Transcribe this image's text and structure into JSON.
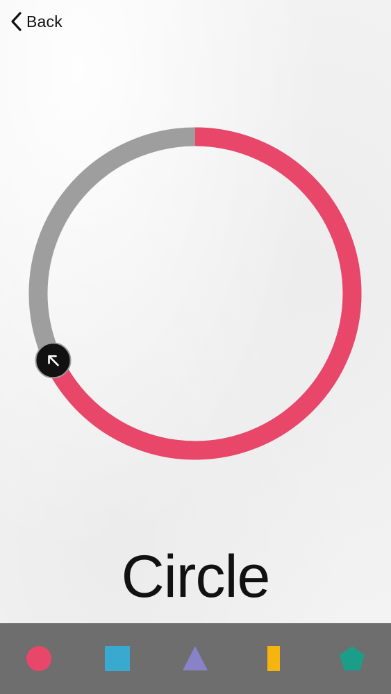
{
  "nav": {
    "back_label": "Back"
  },
  "shape_title": "Circle",
  "progress": {
    "fraction": 0.68,
    "track_color": "#9e9e9e",
    "fill_color": "#e8476a",
    "handle_color": "#111111",
    "handle_icon": "arrow-up-left-icon"
  },
  "shapes": [
    {
      "name": "circle",
      "color": "#e8476a"
    },
    {
      "name": "square",
      "color": "#3aa9d0"
    },
    {
      "name": "triangle",
      "color": "#8a82c8"
    },
    {
      "name": "rectangle",
      "color": "#f6b40e"
    },
    {
      "name": "pentagon",
      "color": "#1a9e8a"
    }
  ]
}
